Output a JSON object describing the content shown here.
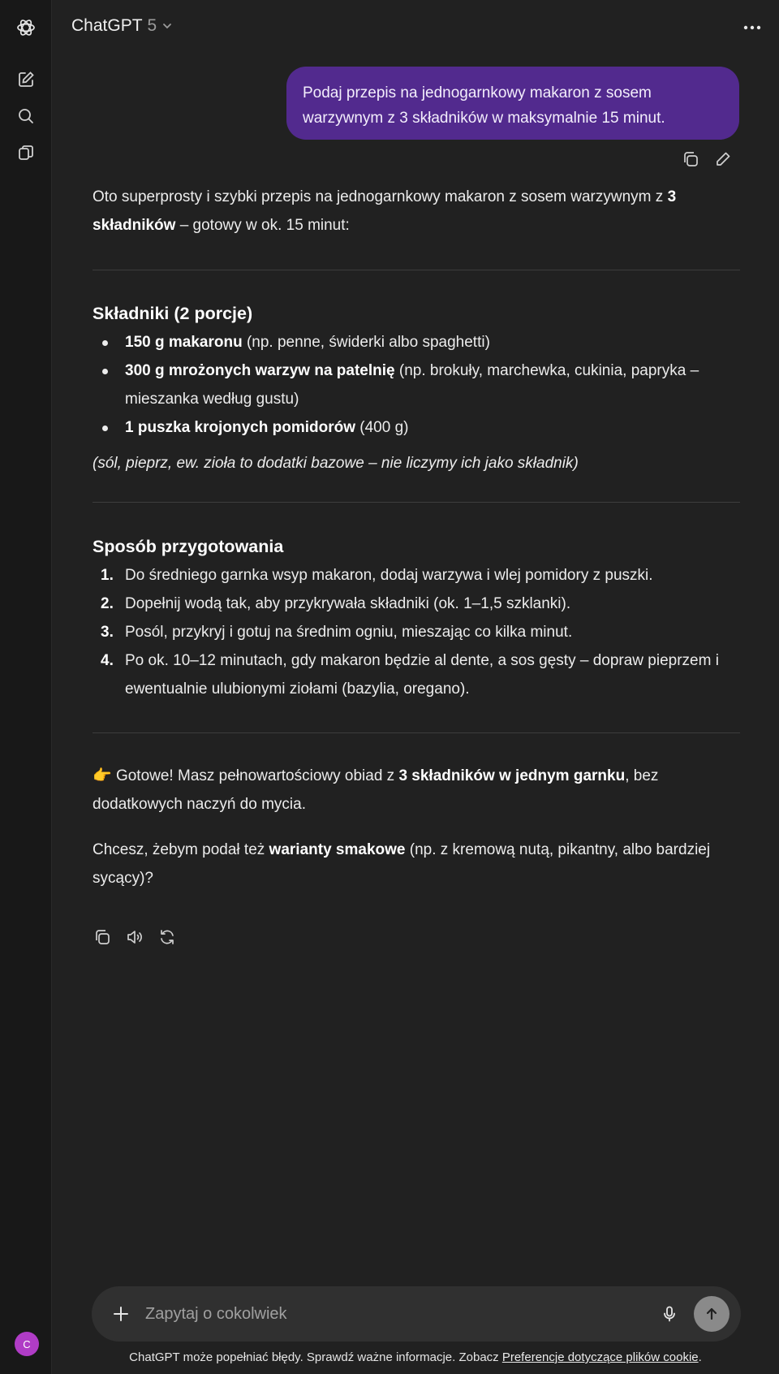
{
  "app": {
    "name": "ChatGPT",
    "version": "5"
  },
  "colors": {
    "background": "#212121",
    "sidebar": "#181818",
    "user_bubble": "#522a8e",
    "avatar": "#b03cc6"
  },
  "sidebar": {
    "icons": [
      "openai-logo-icon",
      "new-chat-icon",
      "search-icon",
      "library-icon"
    ],
    "avatar_letter": "C"
  },
  "conversation": {
    "user_message": "Podaj przepis na jednogarnkowy makaron z sosem warzywnym z 3 składników w maksymalnie 15 minut.",
    "answer": {
      "intro_pre": "Oto superprosty i szybki przepis na jednogarnkowy makaron z sosem warzywnym z ",
      "intro_bold": "3 składników",
      "intro_post": " – gotowy w ok. 15 minut:",
      "ingredients_heading": "Składniki (2 porcje)",
      "ingredients": [
        {
          "bold": "150 g makaronu",
          "rest": " (np. penne, świderki albo spaghetti)"
        },
        {
          "bold": "300 g mrożonych warzyw na patelnię",
          "rest": " (np. brokuły, marchewka, cukinia, papryka – mieszanka według gustu)"
        },
        {
          "bold": "1 puszka krojonych pomidorów",
          "rest": " (400 g)"
        }
      ],
      "note": "(sól, pieprz, ew. zioła to dodatki bazowe – nie liczymy ich jako składnik)",
      "method_heading": "Sposób przygotowania",
      "steps": [
        {
          "num": "1.",
          "text": "Do średniego garnka wsyp makaron, dodaj warzywa i wlej pomidory z puszki."
        },
        {
          "num": "2.",
          "text": "Dopełnij wodą tak, aby przykrywała składniki (ok. 1–1,5 szklanki)."
        },
        {
          "num": "3.",
          "text": "Posól, przykryj i gotuj na średnim ogniu, mieszając co kilka minut."
        },
        {
          "num": "4.",
          "text": "Po ok. 10–12 minutach, gdy makaron będzie al dente, a sos gęsty – dopraw pieprzem i ewentualnie ulubionymi ziołami (bazylia, oregano)."
        }
      ],
      "done_emoji": "👉",
      "done_pre": " Gotowe! Masz pełnowartościowy obiad z ",
      "done_bold": "3 składników w jednym garnku",
      "done_post": ", bez dodatkowych naczyń do mycia.",
      "question_pre": "Chcesz, żebym podał też ",
      "question_bold": "warianty smakowe",
      "question_post": " (np. z kremową nutą, pikantny, albo bardziej sycący)?"
    }
  },
  "composer": {
    "placeholder": "Zapytaj o cokolwiek"
  },
  "footer": {
    "disclaimer": "ChatGPT może popełniać błędy. Sprawdź ważne informacje. Zobacz ",
    "link": "Preferencje dotyczące plików cookie",
    "end": "."
  }
}
